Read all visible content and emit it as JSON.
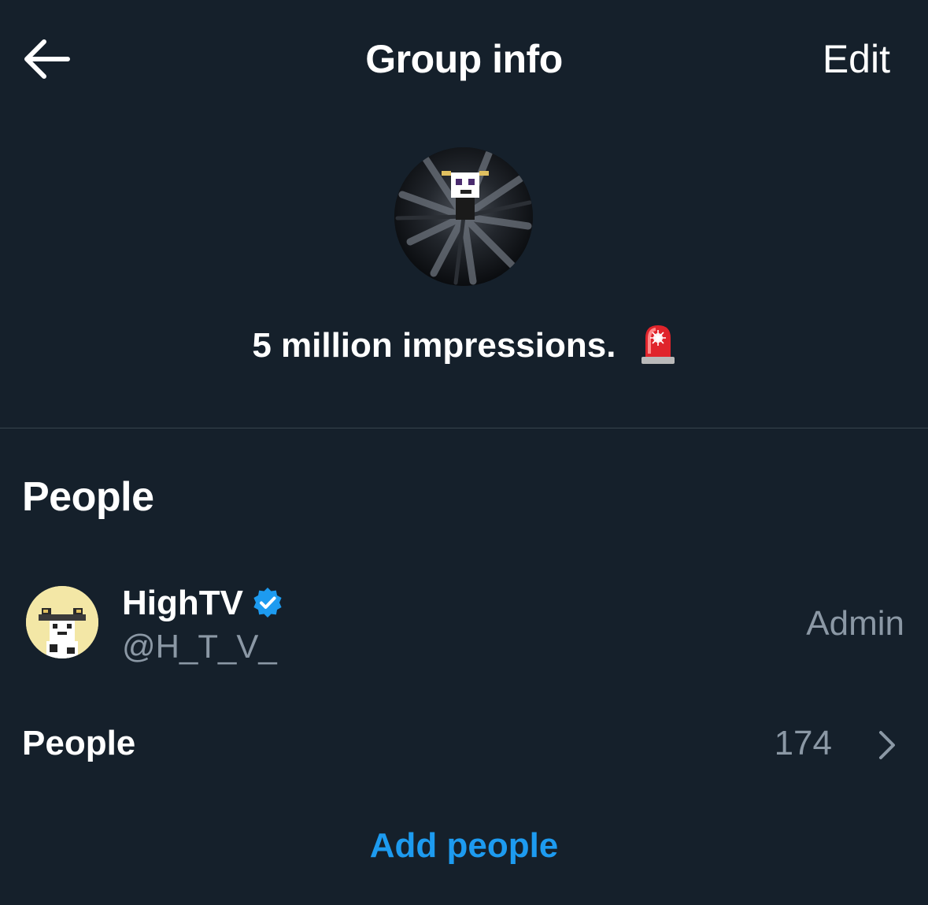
{
  "header": {
    "title": "Group info",
    "edit_label": "Edit",
    "back_icon": "arrow-left-icon"
  },
  "group": {
    "name": "5 million impressions.",
    "emoji_icon": "police-light-icon"
  },
  "people_section": {
    "heading": "People",
    "members": [
      {
        "name": "HighTV",
        "handle": "@H_T_V_",
        "role": "Admin",
        "verified": true
      }
    ],
    "people_row_label": "People",
    "people_count": "174",
    "add_people_label": "Add people"
  },
  "colors": {
    "background": "#15202b",
    "text_primary": "#ffffff",
    "text_secondary": "#8b98a5",
    "accent": "#1d9bf0",
    "divider": "#38444d"
  }
}
